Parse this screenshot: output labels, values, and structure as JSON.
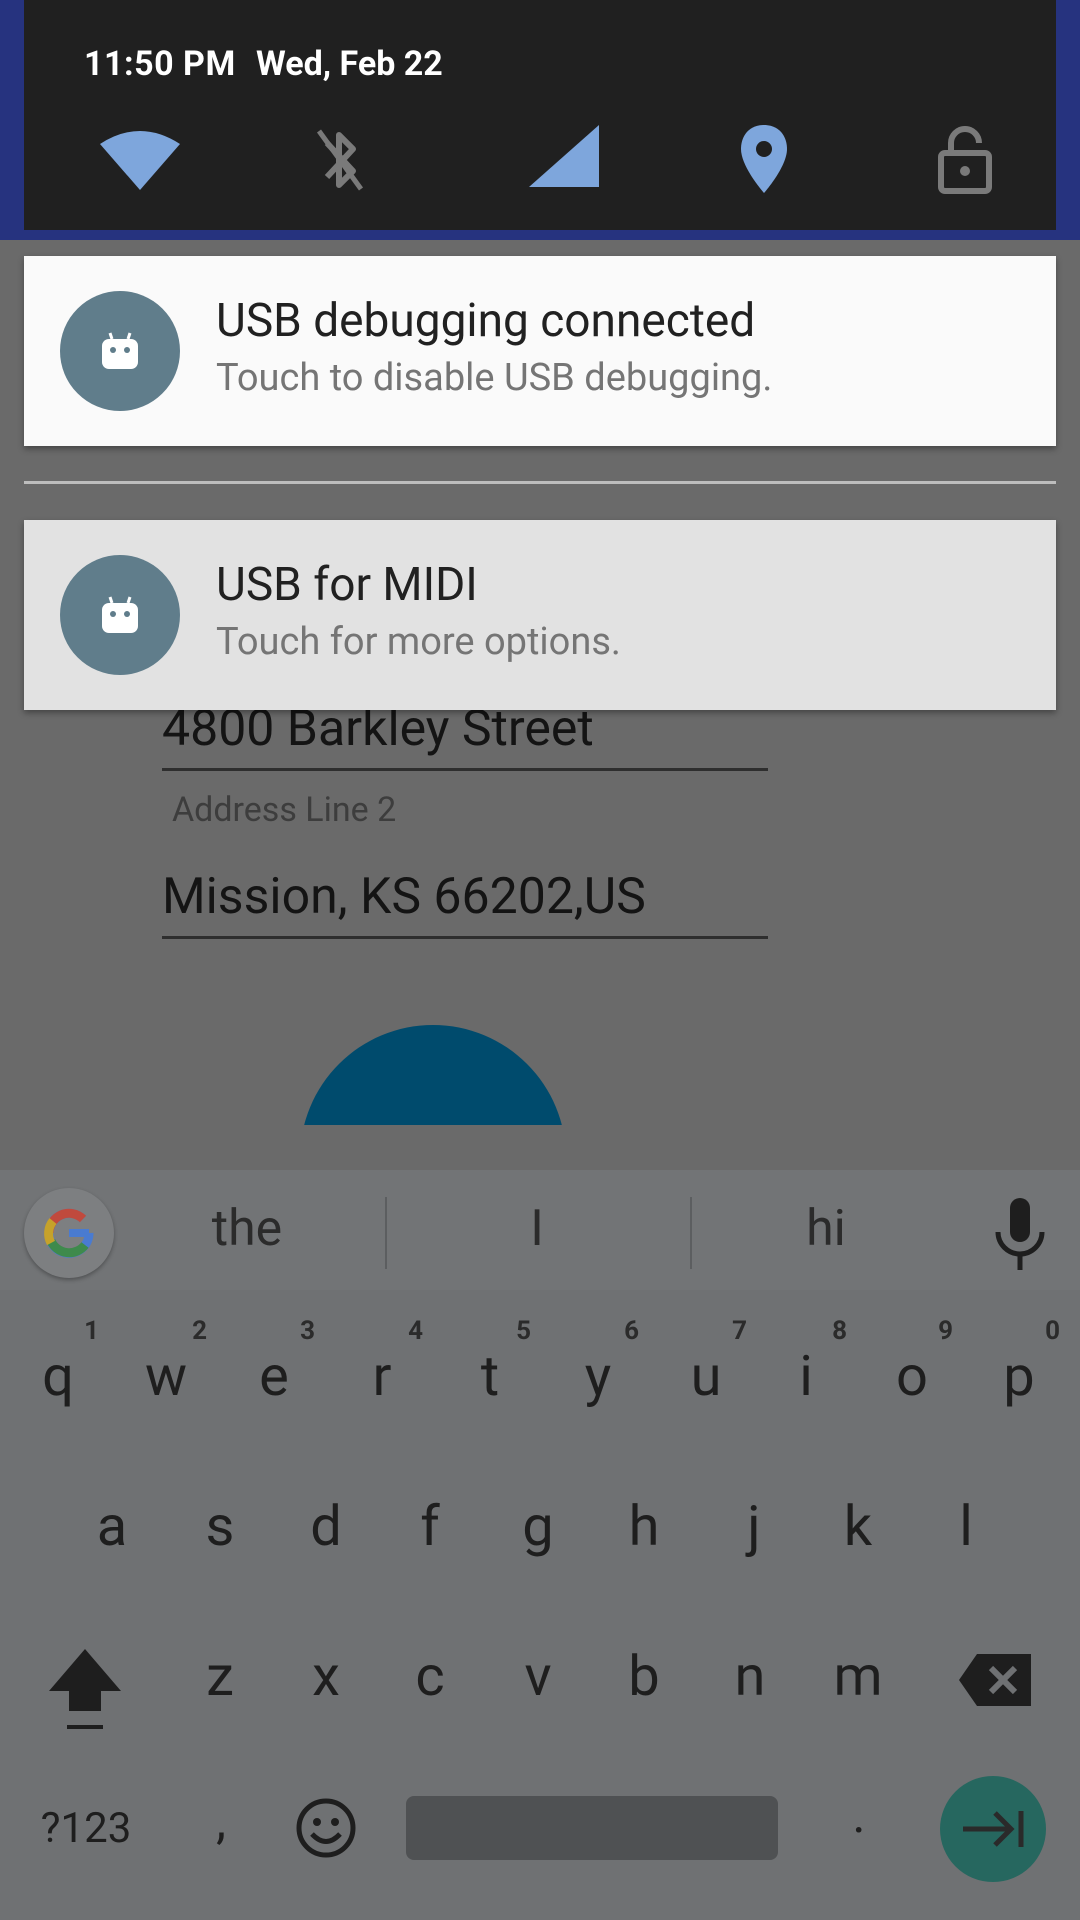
{
  "status_bar": {
    "time": "11:50 PM",
    "date": "Wed, Feb 22"
  },
  "quick_settings": [
    {
      "icon": "wifi-icon",
      "state": "on"
    },
    {
      "icon": "bluetooth-off-icon",
      "state": "off"
    },
    {
      "icon": "cellular-signal-icon",
      "state": "on"
    },
    {
      "icon": "location-icon",
      "state": "on"
    },
    {
      "icon": "screen-lock-icon",
      "state": "off"
    }
  ],
  "notifications": [
    {
      "title": "USB debugging connected",
      "text": "Touch to disable USB debugging.",
      "icon": "android-icon"
    },
    {
      "title": "USB for MIDI",
      "text": "Touch for more options.",
      "icon": "android-icon"
    }
  ],
  "form": {
    "address_line1_value": "4800 Barkley Street",
    "address_line2_label": "Address Line 2",
    "address_line2_value": "Mission, KS 66202,US"
  },
  "keyboard": {
    "suggestions": [
      "the",
      "I",
      "hi"
    ],
    "row1": [
      {
        "key": "q",
        "hint": "1"
      },
      {
        "key": "w",
        "hint": "2"
      },
      {
        "key": "e",
        "hint": "3"
      },
      {
        "key": "r",
        "hint": "4"
      },
      {
        "key": "t",
        "hint": "5"
      },
      {
        "key": "y",
        "hint": "6"
      },
      {
        "key": "u",
        "hint": "7"
      },
      {
        "key": "i",
        "hint": "8"
      },
      {
        "key": "o",
        "hint": "9"
      },
      {
        "key": "p",
        "hint": "0"
      }
    ],
    "row2": [
      "a",
      "s",
      "d",
      "f",
      "g",
      "h",
      "j",
      "k",
      "l"
    ],
    "row3": [
      "z",
      "x",
      "c",
      "v",
      "b",
      "n",
      "m"
    ],
    "symbols_label": "?123",
    "comma_label": ",",
    "period_label": "."
  },
  "colors": {
    "notification_icon_bg": "#607d8b",
    "enter_key": "#26675f",
    "accent_fab": "#004b6d"
  }
}
